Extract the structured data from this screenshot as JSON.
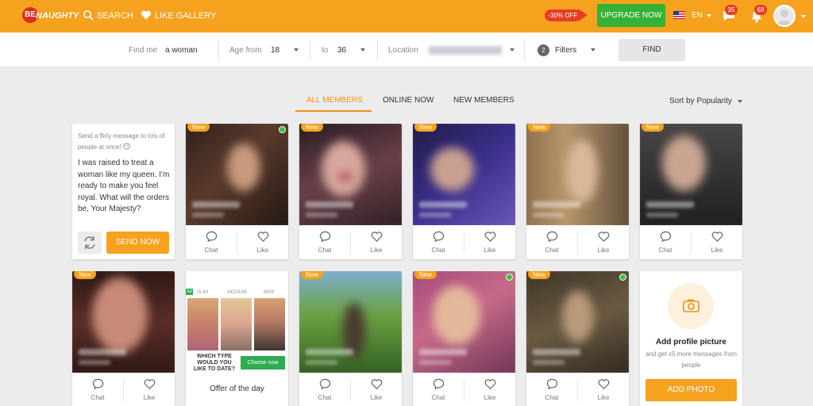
{
  "brand": {
    "logo_badge": "BE",
    "logo_word": "NAUGHTY"
  },
  "header": {
    "nav": [
      {
        "label": "SEARCH",
        "icon": "search-icon"
      },
      {
        "label": "LIKE GALLERY",
        "icon": "heart-icon"
      }
    ],
    "promo": "-30% OFF",
    "upgrade_label": "UPGRADE NOW",
    "language": "EN",
    "messages_count": "35",
    "notifications_count": "68"
  },
  "search": {
    "find_me_label": "Find me",
    "find_me_value": "a woman",
    "age_from_label": "Age from",
    "age_from_value": "18",
    "age_to_label": "to",
    "age_to_value": "36",
    "location_label": "Location",
    "filters_count": "2",
    "filters_label": "Filters",
    "find_label": "FIND"
  },
  "tabs": {
    "items": [
      "ALL MEMBERS",
      "ONLINE NOW",
      "NEW MEMBERS"
    ],
    "active": "ALL MEMBERS",
    "sort_label": "Sort by Popularity"
  },
  "message_card": {
    "hint": "Send a flirty message to lots of people at once!",
    "text": "I was raised to treat a woman like my queen. I'm ready to make you feel royal. What will the orders be, Your Majesty?",
    "send_label": "SEND NOW"
  },
  "member_card": {
    "new_label": "New",
    "chat_label": "Chat",
    "like_label": "Like"
  },
  "ad_card": {
    "badge": "Ad",
    "options": [
      "SLIM",
      "MEDIUM",
      "BBW"
    ],
    "question": "WHICH TYPE WOULD YOU LIKE TO DATE?",
    "button": "Choose now",
    "offer": "Offer of the day"
  },
  "add_photo_card": {
    "title": "Add profile picture",
    "subtitle": "and get x5 more messages from people",
    "button": "ADD PHOTO"
  },
  "colors": {
    "brand_orange": "#f6a21e",
    "upgrade_green": "#35b235",
    "promo_red": "#e83d22",
    "active_tab": "#f0941a"
  }
}
